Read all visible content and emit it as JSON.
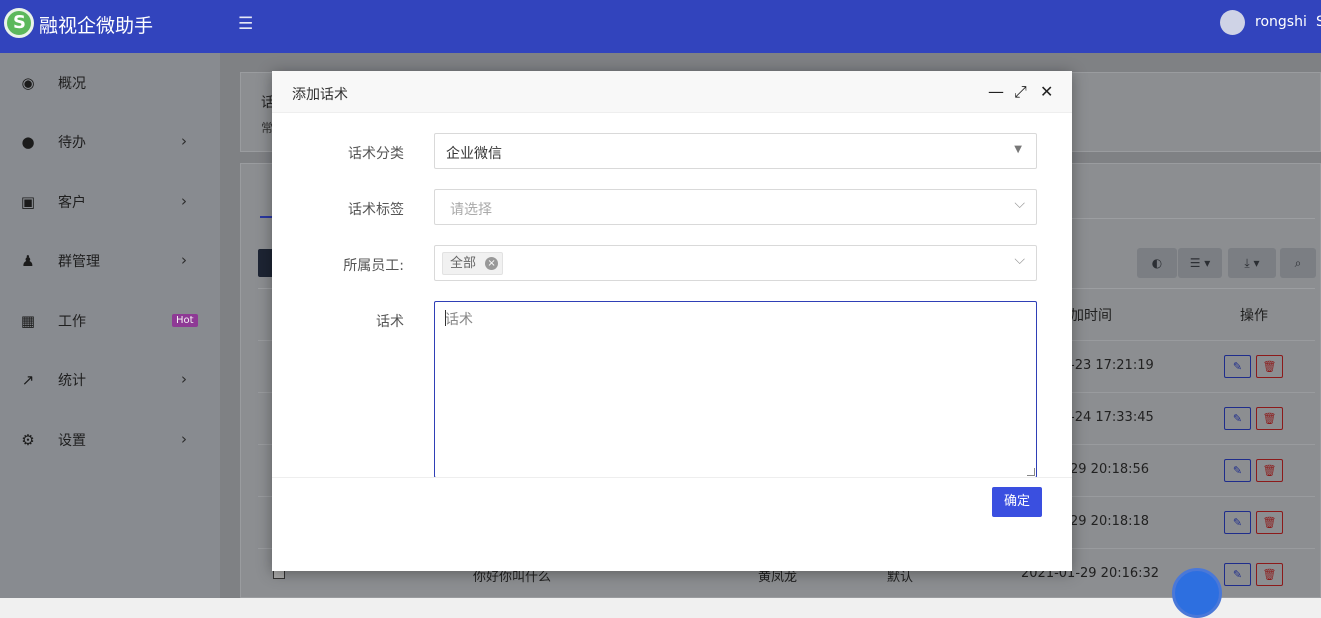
{
  "app": {
    "brand": "融视企微助手",
    "user": "rongshi",
    "edge_glyph": "S"
  },
  "sidebar": {
    "items": [
      {
        "label": "概况",
        "icon": "dashboard-icon",
        "glyph": "◉",
        "arrow": ""
      },
      {
        "label": "待办",
        "icon": "compass-icon",
        "glyph": "●",
        "arrow": "›"
      },
      {
        "label": "客户",
        "icon": "id-card-icon",
        "glyph": "▣",
        "arrow": "›"
      },
      {
        "label": "群管理",
        "icon": "users-icon",
        "glyph": "♟",
        "arrow": "›"
      },
      {
        "label": "工作",
        "icon": "grid-icon",
        "glyph": "▦",
        "badge": "Hot",
        "arrow": ""
      },
      {
        "label": "统计",
        "icon": "line-chart-icon",
        "glyph": "↗",
        "arrow": "›"
      },
      {
        "label": "设置",
        "icon": "gear-icon",
        "glyph": "⚙",
        "arrow": "›"
      }
    ]
  },
  "background": {
    "panel_title_fragment": "话",
    "panel_sub_fragment": "常",
    "toolbar": {
      "toggle": "◐",
      "columns": "☰ ▾",
      "export": "⤓ ▾",
      "search": "⌕"
    },
    "table": {
      "header_time": "加时间",
      "header_ops": "操作",
      "times": [
        "-23 17:21:19",
        "-24 17:33:45",
        "29 20:18:56",
        "29 20:18:18"
      ],
      "edit_glyph": "✎",
      "delete_glyph": "🗑",
      "last_row": {
        "text": "你好你叫什么",
        "staff": "黄凤龙",
        "category": "默认",
        "time": "2021-01-29 20:16:32"
      }
    }
  },
  "modal": {
    "title": "添加话术",
    "controls": {
      "minimize": "—",
      "maximize": "⤢",
      "close": "✕"
    },
    "fields": {
      "category_label": "话术分类",
      "category_value": "企业微信",
      "tag_label": "话术标签",
      "tag_placeholder": "请选择",
      "staff_label": "所属员工:",
      "staff_tag": "全部",
      "content_label": "话术",
      "content_placeholder": "话术"
    },
    "confirm": "确定"
  },
  "colors": {
    "topbar": "#3244bd",
    "primary": "#3a4fe0",
    "hot_badge": "#8e3a95"
  }
}
